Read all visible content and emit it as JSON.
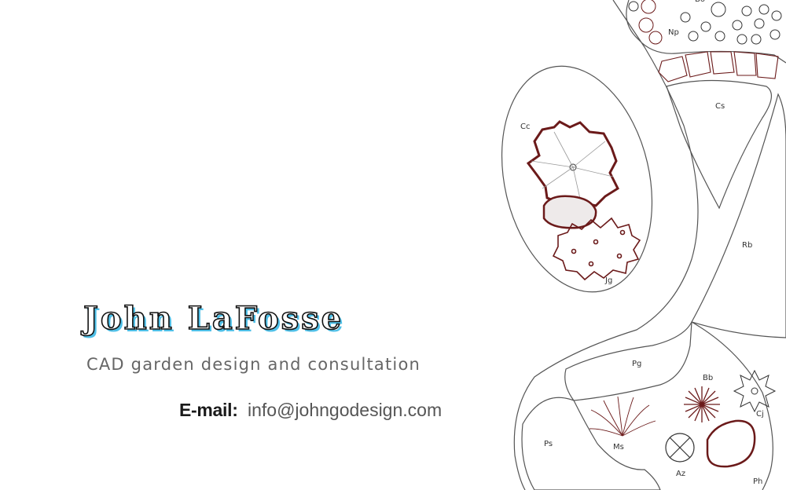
{
  "card": {
    "name": "John LaFosse",
    "tagline": "CAD garden design and consultation",
    "contact": {
      "email_label": "E-mail:",
      "email": "info@johngodesign.com"
    }
  },
  "plan": {
    "labels": {
      "np": "Np",
      "cs": "Cs",
      "cc": "Cc",
      "jg": "Jg",
      "rb": "Rb",
      "pg": "Pg",
      "bb": "Bb",
      "cj": "Cj",
      "ps": "Ps",
      "ms": "Ms",
      "az": "Az",
      "ph": "Ph",
      "bo": "Bo"
    }
  },
  "colors": {
    "plant_outline": "#6b1a1a",
    "bed_line": "#555555",
    "name_shadow": "#4fc0e8"
  }
}
